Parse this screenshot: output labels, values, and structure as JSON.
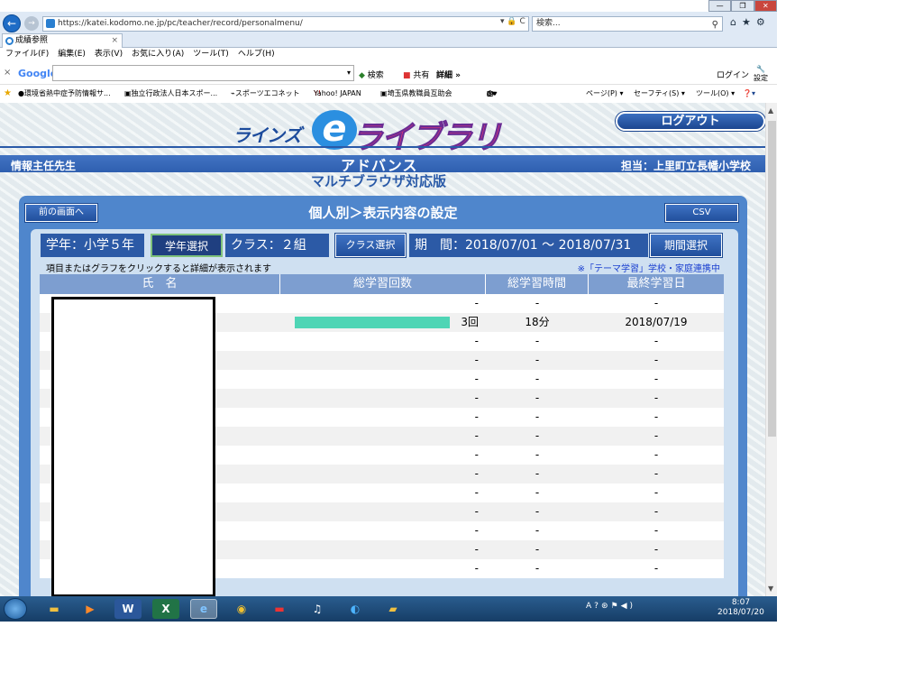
{
  "browser": {
    "url": "https://katei.kodomo.ne.jp/pc/teacher/record/personalmenu/",
    "addr_controls": "▾ 🔒 C",
    "search_placeholder": "検索...",
    "tab_title": "成績参照",
    "tab_close": "×",
    "menu": [
      "ファイル(F)",
      "編集(E)",
      "表示(V)",
      "お気に入り(A)",
      "ツール(T)",
      "ヘルプ(H)"
    ],
    "google_toolbar": {
      "close": "×",
      "logo": "Google",
      "search_btn": "検索",
      "share_btn": "共有",
      "detail_btn": "詳細 »",
      "login": "ログイン",
      "settings": "設定"
    },
    "favorites": [
      "環境省熱中症予防情報サ...",
      "独立行政法人日本スポー...",
      "スポーツエコネット",
      "Yahoo! JAPAN",
      "埼玉県教職員互助会"
    ],
    "command_bar": [
      "ページ(P) ▾",
      "セーフティ(S) ▾",
      "ツール(O) ▾"
    ]
  },
  "header": {
    "logo_small": "ラインズ",
    "logo_e": "e",
    "logo_big": "ライブラリ",
    "logout": "ログアウト",
    "teacher": "情報主任先生",
    "advance": "アドバンス",
    "multi_browser": "マルチブラウザ対応版",
    "school": "担当：上里町立長幡小学校"
  },
  "panel": {
    "back_button": "前の画面へ",
    "title": "個人別＞表示内容の設定",
    "csv_button": "CSV",
    "grade": "学年：小学５年",
    "grade_button": "学年選択",
    "class": "クラス：２組",
    "class_button": "クラス選択",
    "period": "期　間：2018/07/01 〜 2018/07/31",
    "period_button": "期間選択",
    "hint": "項目またはグラフをクリックすると詳細が表示されます",
    "link": "※「テーマ学習」学校・家庭連携中"
  },
  "table": {
    "headers": [
      "氏　名",
      "総学習回数",
      "総学習時間",
      "最終学習日"
    ],
    "rows": [
      {
        "count": "-",
        "time": "-",
        "last": "-",
        "bar": 0
      },
      {
        "count": "3回",
        "time": "18分",
        "last": "2018/07/19",
        "bar": 1
      },
      {
        "count": "-",
        "time": "-",
        "last": "-",
        "bar": 0
      },
      {
        "count": "-",
        "time": "-",
        "last": "-",
        "bar": 0
      },
      {
        "count": "-",
        "time": "-",
        "last": "-",
        "bar": 0
      },
      {
        "count": "-",
        "time": "-",
        "last": "-",
        "bar": 0
      },
      {
        "count": "-",
        "time": "-",
        "last": "-",
        "bar": 0
      },
      {
        "count": "-",
        "time": "-",
        "last": "-",
        "bar": 0
      },
      {
        "count": "-",
        "time": "-",
        "last": "-",
        "bar": 0
      },
      {
        "count": "-",
        "time": "-",
        "last": "-",
        "bar": 0
      },
      {
        "count": "-",
        "time": "-",
        "last": "-",
        "bar": 0
      },
      {
        "count": "-",
        "time": "-",
        "last": "-",
        "bar": 0
      },
      {
        "count": "-",
        "time": "-",
        "last": "-",
        "bar": 0
      },
      {
        "count": "-",
        "time": "-",
        "last": "-",
        "bar": 0
      },
      {
        "count": "-",
        "time": "-",
        "last": "-",
        "bar": 0
      }
    ]
  },
  "taskbar": {
    "apps": [
      "explorer-icon",
      "media-player-icon",
      "word-icon",
      "excel-icon",
      "ie-icon",
      "chrome-icon",
      "app-icon",
      "itunes-icon",
      "ie-blue-icon",
      "folder-icon"
    ],
    "time": "8:07",
    "date": "2018/07/20"
  },
  "colors": {
    "accent": "#2c5aa6",
    "bar": "#4fd5b5",
    "link": "#1a3fd0"
  }
}
